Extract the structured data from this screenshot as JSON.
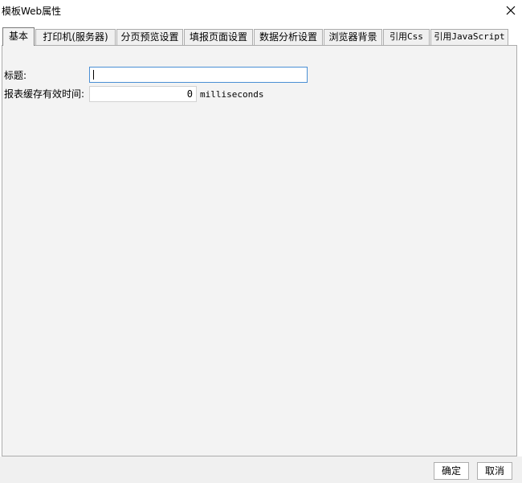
{
  "window": {
    "title": "模板Web属性"
  },
  "tabs": [
    {
      "label": "基本"
    },
    {
      "label": "打印机(服务器)"
    },
    {
      "label": "分页预览设置"
    },
    {
      "label": "填报页面设置"
    },
    {
      "label": "数据分析设置"
    },
    {
      "label": "浏览器背景"
    },
    {
      "label": "引用Css"
    },
    {
      "label": "引用JavaScript"
    }
  ],
  "basic": {
    "title_label": "标题:",
    "title_value": "",
    "cache_label": "报表缓存有效时间:",
    "cache_value": "0",
    "cache_unit": "milliseconds"
  },
  "footer": {
    "ok_label": "确定",
    "cancel_label": "取消"
  }
}
